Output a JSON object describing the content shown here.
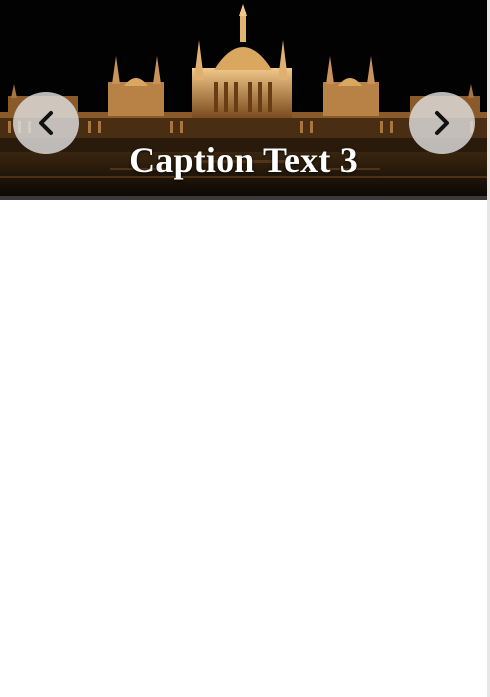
{
  "slideshow": {
    "caption": "Caption Text 3",
    "prev_icon": "chevron-left-icon",
    "next_icon": "chevron-right-icon",
    "image_description_icon": "parliament-night-image"
  },
  "colors": {
    "background": "#ffffff",
    "slide_background": "#020202",
    "nav_button": "#dedede",
    "caption_text": "#ffffff"
  }
}
